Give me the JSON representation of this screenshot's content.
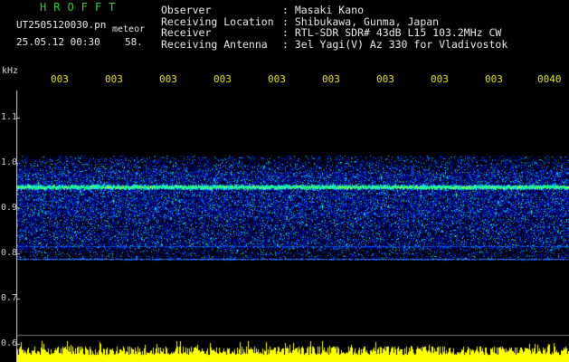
{
  "header": {
    "title": "HROFFT",
    "filename": "UT2505120030.pn",
    "tag": "meteor",
    "datetime": "25.05.12 00:30",
    "count": "58."
  },
  "info": {
    "labels": [
      "Observer",
      "Receiving Location",
      "Receiver",
      "Receiving Antenna"
    ],
    "values": [
      ": Masaki Kano",
      ": Shibukawa, Gunma, Japan",
      ": RTL-SDR SDR# 43dB L15 103.2MHz CW",
      ": 3el Yagi(V) Az 330 for Vladivostok"
    ]
  },
  "axes": {
    "unit": "kHz",
    "y_ticks": [
      {
        "label": "1.1",
        "value": 1.1
      },
      {
        "label": "1.0",
        "value": 1.0
      },
      {
        "label": "0.9",
        "value": 0.9
      },
      {
        "label": "0.8",
        "value": 0.8
      },
      {
        "label": "0.7",
        "value": 0.7
      },
      {
        "label": "0.6",
        "value": 0.6
      }
    ],
    "time_labels": [
      "003",
      "003",
      "003",
      "003",
      "003",
      "003",
      "003",
      "003",
      "003",
      "0040"
    ]
  },
  "colors": {
    "background": "#000000",
    "title": "#2ecc40",
    "time_labels": "#e6e600",
    "signal_band": "#00ff66",
    "noise_bars": "#ffff00"
  }
}
